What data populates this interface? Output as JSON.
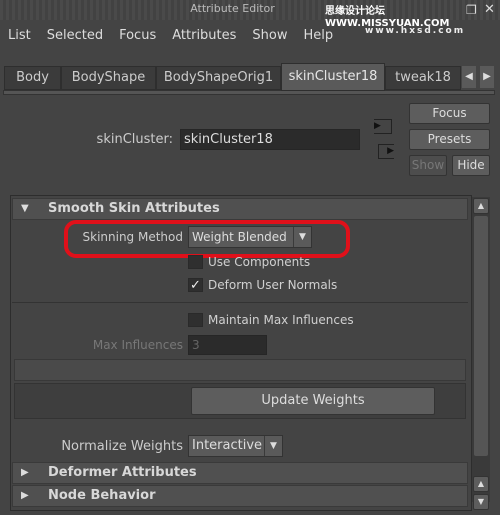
{
  "window": {
    "title": "Attribute Editor"
  },
  "watermark": {
    "line1": "思缘设计论坛 WWW.MISSYUAN.COM",
    "line2": "www.hxsd.com"
  },
  "menu": [
    "List",
    "Selected",
    "Focus",
    "Attributes",
    "Show",
    "Help"
  ],
  "tabs": [
    {
      "label": "Body"
    },
    {
      "label": "BodyShape"
    },
    {
      "label": "BodyShapeOrig1"
    },
    {
      "label": "skinCluster18",
      "active": true
    },
    {
      "label": "tweak18"
    }
  ],
  "node": {
    "label": "skinCluster:",
    "value": "skinCluster18"
  },
  "buttons": {
    "focus": "Focus",
    "presets": "Presets",
    "show": "Show",
    "hide": "Hide"
  },
  "sections": {
    "smooth": "Smooth Skin Attributes",
    "deformer": "Deformer Attributes",
    "node_behavior": "Node Behavior"
  },
  "smooth": {
    "skinning_method_label": "Skinning Method",
    "skinning_method": "Weight Blended",
    "use_components": {
      "label": "Use Components",
      "checked": false
    },
    "deform_user_normals": {
      "label": "Deform User Normals",
      "checked": true
    },
    "maintain_max": {
      "label": "Maintain Max Influences",
      "checked": false
    },
    "max_influences_label": "Max Influences",
    "max_influences": "3",
    "update_weights": "Update Weights",
    "normalize_label": "Normalize Weights",
    "normalize": "Interactive"
  },
  "colors": {
    "highlight": "#e0101a"
  },
  "checkmark": "✓"
}
